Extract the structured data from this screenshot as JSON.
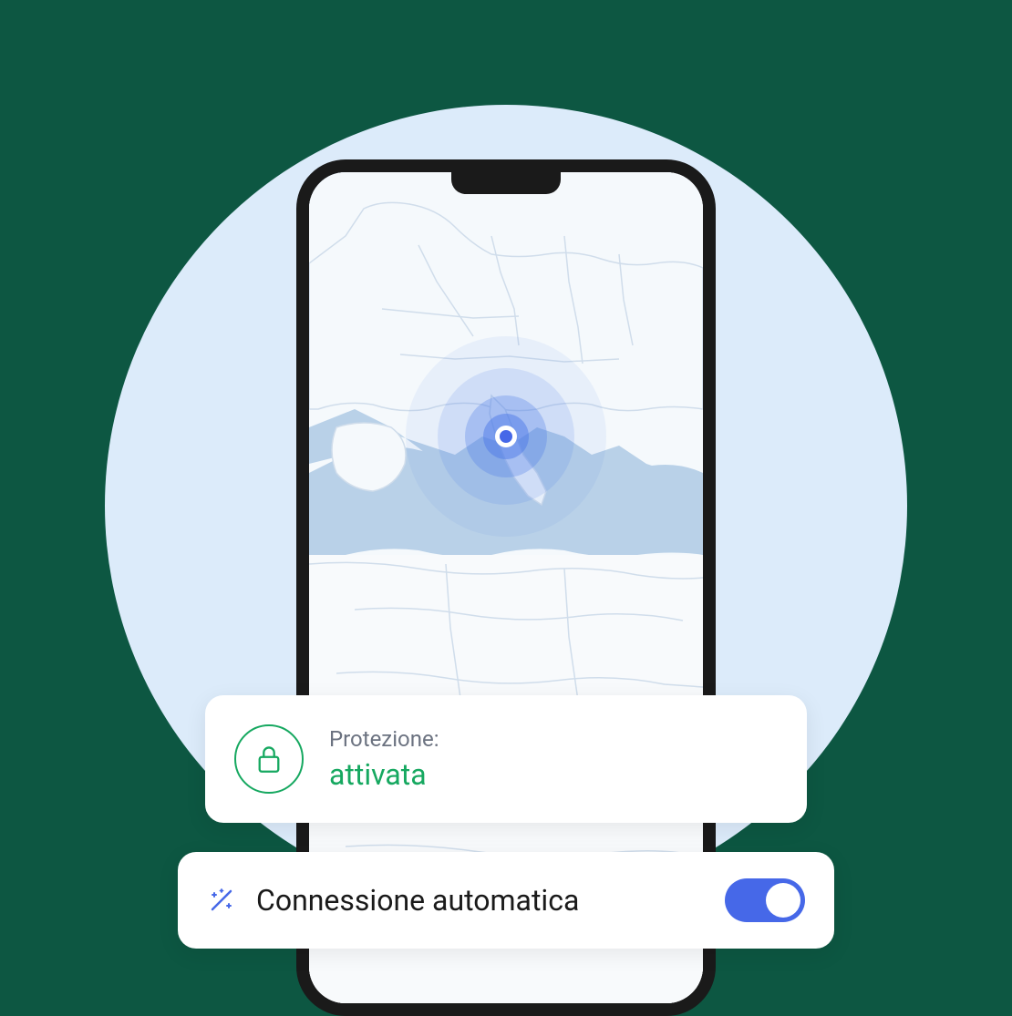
{
  "protection": {
    "label": "Protezione:",
    "status": "attivata"
  },
  "autoConnect": {
    "label": "Connessione automatica",
    "enabled": true
  },
  "colors": {
    "background": "#0d5742",
    "circle": "#dcebfa",
    "accent": "#4668e8",
    "success": "#16a860"
  }
}
